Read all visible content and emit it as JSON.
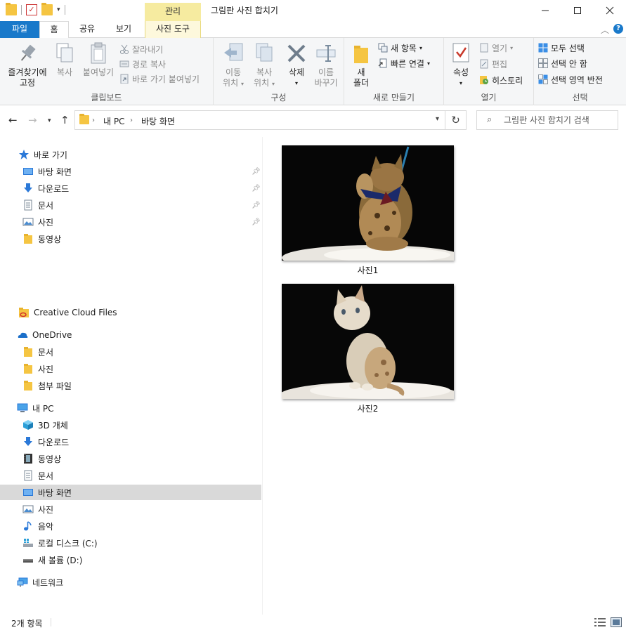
{
  "window": {
    "title": "그림판 사진 합치기",
    "context_tab_group": "관리",
    "help": "?"
  },
  "tabs": {
    "file": "파일",
    "home": "홈",
    "share": "공유",
    "view": "보기",
    "picture_tools": "사진 도구"
  },
  "ribbon": {
    "clipboard": {
      "label": "클립보드",
      "pin": "즐겨찾기에\n고정",
      "pin_line1": "즐겨찾기에",
      "pin_line2": "고정",
      "copy": "복사",
      "paste": "붙여넣기",
      "cut": "잘라내기",
      "copy_path": "경로 복사",
      "paste_shortcut": "바로 가기 붙여넣기"
    },
    "organize": {
      "label": "구성",
      "move_to_1": "이동",
      "move_to_2": "위치",
      "copy_to_1": "복사",
      "copy_to_2": "위치",
      "delete": "삭제",
      "rename_1": "이름",
      "rename_2": "바꾸기"
    },
    "new": {
      "label": "새로 만들기",
      "new_folder_1": "새",
      "new_folder_2": "폴더",
      "new_item": "새 항목",
      "easy_access": "빠른 연결"
    },
    "open": {
      "label": "열기",
      "properties": "속성",
      "open": "열기",
      "edit": "편집",
      "history": "히스토리"
    },
    "select": {
      "label": "선택",
      "select_all": "모두 선택",
      "select_none": "선택 안 함",
      "invert": "선택 영역 반전"
    }
  },
  "address": {
    "crumbs": [
      "내 PC",
      "바탕 화면"
    ],
    "search_placeholder": "그림판 사진 합치기 검색"
  },
  "nav": {
    "quick_access": "바로 가기",
    "quick_items": [
      "바탕 화면",
      "다운로드",
      "문서",
      "사진",
      "동영상"
    ],
    "creative_cloud": "Creative Cloud Files",
    "onedrive": "OneDrive",
    "onedrive_items": [
      "문서",
      "사진",
      "첨부 파일"
    ],
    "this_pc": "내 PC",
    "pc_items": [
      "3D 개체",
      "다운로드",
      "동영상",
      "문서",
      "바탕 화면",
      "사진",
      "음악",
      "로컬 디스크 (C:)",
      "새 볼륨 (D:)"
    ],
    "network": "네트워크"
  },
  "files": [
    {
      "name": "사진1",
      "icon": "bengal-cat-playing-photo"
    },
    {
      "name": "사진2",
      "icon": "bengal-cat-sitting-photo"
    }
  ],
  "status": {
    "count": "2개 항목"
  },
  "colors": {
    "accent": "#1979ca",
    "context_tab": "#f6eba0",
    "selected_row": "#d9d9d9",
    "folder": "#f5c542"
  }
}
